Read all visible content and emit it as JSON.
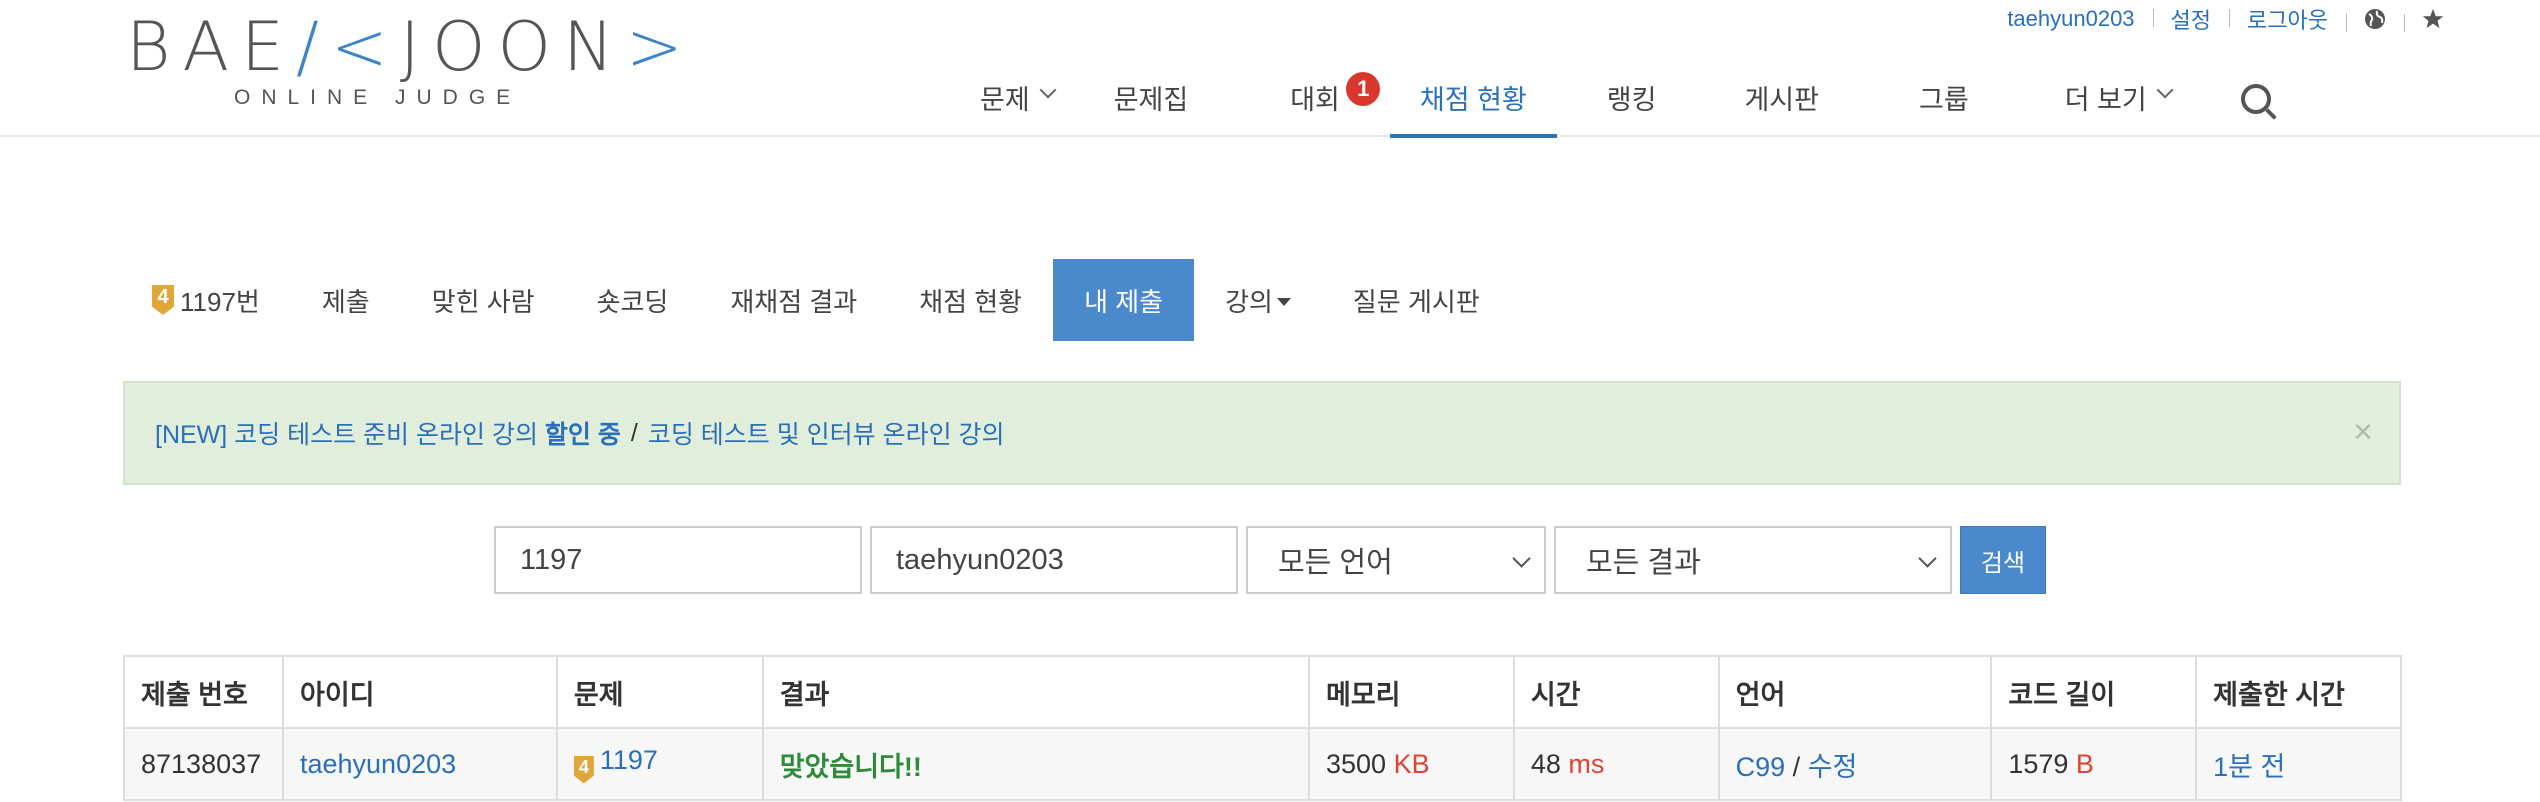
{
  "logo": {
    "left": "BAE",
    "mid": "JOON",
    "sub": "ONLINE JUDGE"
  },
  "topbar": {
    "username": "taehyun0203",
    "settings": "설정",
    "logout": "로그아웃",
    "globe_icon": "globe-icon",
    "star_icon": "star-icon"
  },
  "nav": {
    "problems": "문제",
    "workbook": "문제집",
    "contest": "대회",
    "contest_badge": "1",
    "status": "채점 현황",
    "ranking": "랭킹",
    "board": "게시판",
    "group": "그룹",
    "more": "더 보기"
  },
  "subnav": {
    "problem_tier": "4",
    "problem": "1197번",
    "submit": "제출",
    "solvers": "맞힌 사람",
    "shortcoding": "숏코딩",
    "rejudge": "재채점 결과",
    "status": "채점 현황",
    "my_submissions": "내 제출",
    "lecture": "강의",
    "qna": "질문 게시판"
  },
  "alert": {
    "part1": "[NEW] 코딩 테스트 준비 온라인 강의 ",
    "part1_bold": "할인 중",
    "separator": "/",
    "part2": "코딩 테스트 및 인터뷰 온라인 강의",
    "close": "×"
  },
  "search": {
    "problem_id": "1197",
    "user_id": "taehyun0203",
    "language": "모든 언어",
    "result": "모든 결과",
    "button": "검색"
  },
  "table": {
    "headers": [
      "제출 번호",
      "아이디",
      "문제",
      "결과",
      "메모리",
      "시간",
      "언어",
      "코드 길이",
      "제출한 시간"
    ],
    "rows": [
      {
        "submission_id": "87138037",
        "user": "taehyun0203",
        "problem_tier": "4",
        "problem": "1197",
        "result": "맞았습니다!!",
        "memory": "3500",
        "memory_unit": "KB",
        "time": "48",
        "time_unit": "ms",
        "language": "C99",
        "lang_sep": "/",
        "edit": "수정",
        "code_length": "1579",
        "code_unit": "B",
        "submitted": "1분 전"
      }
    ]
  },
  "colors": {
    "accent": "#2a73ba",
    "active_tab": "#4a89cc",
    "success": "#2e8b3a",
    "unit": "#dd4433",
    "tier": "#e0a63a",
    "badge": "#d9372e",
    "alert_bg": "#e0eedb"
  }
}
